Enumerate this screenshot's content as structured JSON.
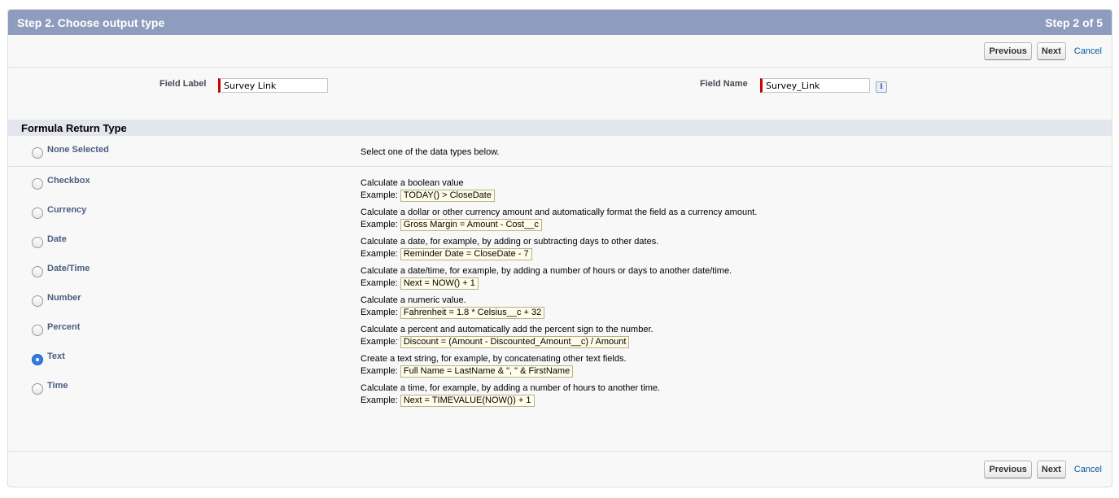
{
  "header": {
    "title": "Step 2. Choose output type",
    "step": "Step 2 of 5"
  },
  "buttons": {
    "previous": "Previous",
    "next": "Next",
    "cancel": "Cancel"
  },
  "fields": {
    "field_label": {
      "label": "Field Label",
      "value": "Survey Link"
    },
    "field_name": {
      "label": "Field Name",
      "value": "Survey_Link"
    },
    "info_icon": "i"
  },
  "section_title": "Formula Return Type",
  "none_option": {
    "label": "None Selected",
    "description": "Select one of the data types below."
  },
  "example_prefix": "Example:",
  "options": [
    {
      "label": "Checkbox",
      "description": "Calculate a boolean value",
      "example": "TODAY() > CloseDate",
      "selected": false
    },
    {
      "label": "Currency",
      "description": "Calculate a dollar or other currency amount and automatically format the field as a currency amount.",
      "example": "Gross Margin = Amount - Cost__c",
      "selected": false
    },
    {
      "label": "Date",
      "description": "Calculate a date, for example, by adding or subtracting days to other dates.",
      "example": "Reminder Date = CloseDate - 7",
      "selected": false
    },
    {
      "label": "Date/Time",
      "description": "Calculate a date/time, for example, by adding a number of hours or days to another date/time.",
      "example": "Next = NOW() + 1",
      "selected": false
    },
    {
      "label": "Number",
      "description": "Calculate a numeric value.",
      "example": "Fahrenheit = 1.8 * Celsius__c + 32",
      "selected": false
    },
    {
      "label": "Percent",
      "description": "Calculate a percent and automatically add the percent sign to the number.",
      "example": "Discount = (Amount - Discounted_Amount__c) / Amount",
      "selected": false
    },
    {
      "label": "Text",
      "description": "Create a text string, for example, by concatenating other text fields.",
      "example": "Full Name = LastName & \", \" & FirstName",
      "selected": true
    },
    {
      "label": "Time",
      "description": "Calculate a time, for example, by adding a number of hours to another time.",
      "example": "Next = TIMEVALUE(NOW()) + 1",
      "selected": false
    }
  ]
}
